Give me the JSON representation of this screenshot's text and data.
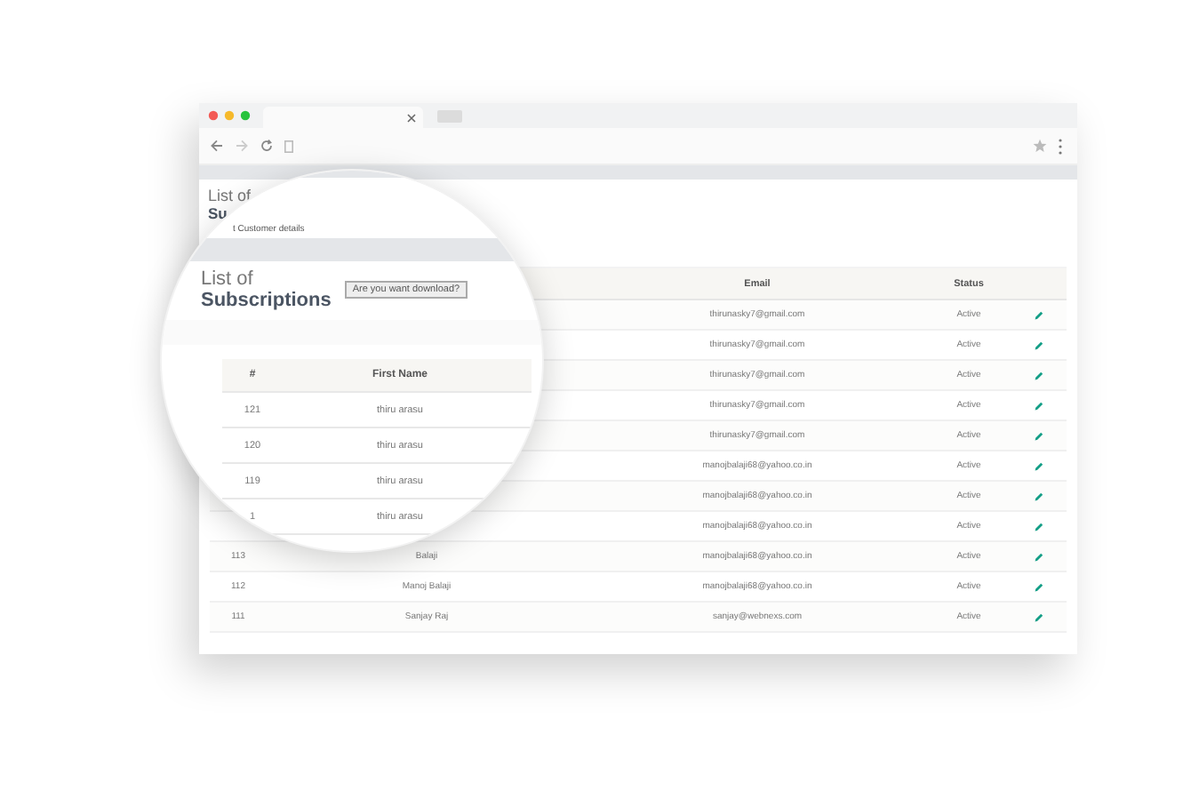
{
  "table": {
    "columns": [
      "Email",
      "Status"
    ],
    "rows": [
      {
        "email": "thirunasky7@gmail.com",
        "status": "Active"
      },
      {
        "email": "thirunasky7@gmail.com",
        "status": "Active"
      },
      {
        "email": "thirunasky7@gmail.com",
        "status": "Active"
      },
      {
        "email": "thirunasky7@gmail.com",
        "status": "Active"
      },
      {
        "email": "thirunasky7@gmail.com",
        "status": "Active"
      },
      {
        "email": "manojbalaji68@yahoo.co.in",
        "status": "Active"
      },
      {
        "email": "manojbalaji68@yahoo.co.in",
        "status": "Active"
      },
      {
        "email": "manojbalaji68@yahoo.co.in",
        "status": "Active"
      },
      {
        "number": "113",
        "first_name": "Balaji",
        "email": "manojbalaji68@yahoo.co.in",
        "status": "Active"
      },
      {
        "number": "112",
        "first_name": "Manoj Balaji",
        "email": "manojbalaji68@yahoo.co.in",
        "status": "Active"
      },
      {
        "number": "111",
        "first_name": "Sanjay Raj",
        "email": "sanjay@webnexs.com",
        "status": "Active"
      }
    ]
  },
  "page_header": {
    "title_light": "List of",
    "title_bold": "Su"
  },
  "magnifier": {
    "top_subtitle": "t Customer details",
    "title_light": "List of",
    "title_bold": "Subscriptions",
    "download_button": "Are you want download?",
    "columns": [
      "#",
      "First Name"
    ],
    "rows": [
      {
        "number": "121",
        "first_name": "thiru arasu"
      },
      {
        "number": "120",
        "first_name": "thiru arasu"
      },
      {
        "number": "119",
        "first_name": "thiru arasu"
      },
      {
        "number": "1",
        "first_name": "thiru arasu"
      }
    ]
  }
}
